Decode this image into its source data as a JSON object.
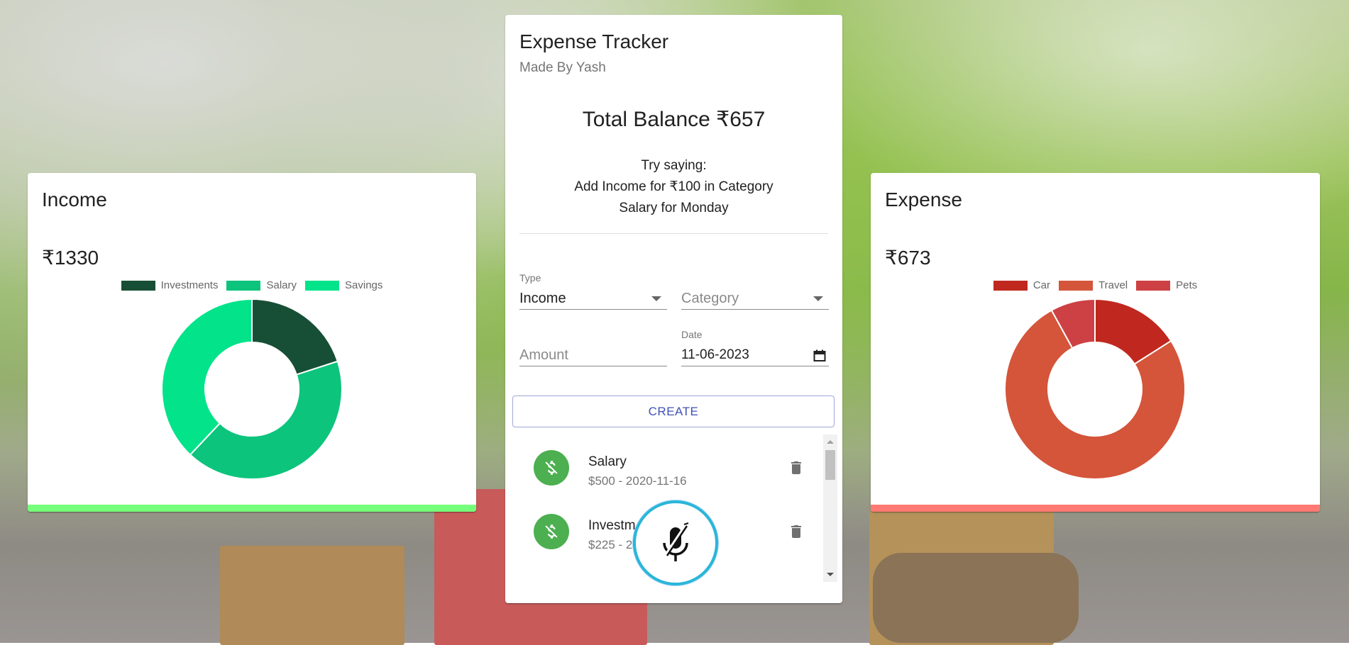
{
  "income": {
    "title": "Income",
    "amount": "₹1330",
    "accent": "#76ff7a",
    "legend": [
      {
        "label": "Investments",
        "color": "#174f36"
      },
      {
        "label": "Salary",
        "color": "#0dc47c"
      },
      {
        "label": "Savings",
        "color": "#03e38a"
      }
    ]
  },
  "expense": {
    "title": "Expense",
    "amount": "₹673",
    "accent": "#ff7a72",
    "legend": [
      {
        "label": "Car",
        "color": "#c0281f"
      },
      {
        "label": "Travel",
        "color": "#d4553a"
      },
      {
        "label": "Pets",
        "color": "#cd4043"
      }
    ]
  },
  "main": {
    "title": "Expense Tracker",
    "subtitle": "Made By Yash",
    "balance": "Total Balance ₹657",
    "hint_line1": "Try saying:",
    "hint_line2": "Add Income for ₹100 in Category",
    "hint_line3": "Salary for Monday",
    "form": {
      "type_label": "Type",
      "type_value": "Income",
      "category_placeholder": "Category",
      "amount_placeholder": "Amount",
      "date_label": "Date",
      "date_value": "11-06-2023",
      "create_label": "CREATE"
    },
    "transactions": [
      {
        "name": "Salary",
        "detail": "$500 - 2020-11-16"
      },
      {
        "name": "Investm",
        "detail": "$225 - 20"
      }
    ]
  },
  "chart_data": [
    {
      "type": "pie",
      "title": "",
      "categories": [
        "Investments",
        "Salary",
        "Savings"
      ],
      "values": [
        20,
        42,
        38
      ],
      "colors": [
        "#174f36",
        "#0dc47c",
        "#03e38a"
      ]
    },
    {
      "type": "pie",
      "title": "",
      "categories": [
        "Car",
        "Travel",
        "Pets"
      ],
      "values": [
        16,
        76,
        8
      ],
      "colors": [
        "#c0281f",
        "#d4553a",
        "#cd4043"
      ]
    }
  ]
}
